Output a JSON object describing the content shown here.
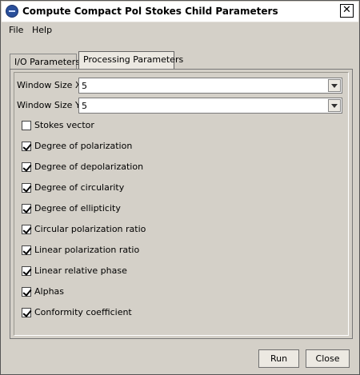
{
  "window": {
    "title": "Compute Compact Pol Stokes Child Parameters",
    "close_glyph": "✕",
    "icon": "app-logo-icon"
  },
  "menu": [
    "File",
    "Help"
  ],
  "tabs": [
    {
      "label": "I/O Parameters",
      "active": false
    },
    {
      "label": "Processing Parameters",
      "active": true
    }
  ],
  "fields": {
    "window_size_x": {
      "label": "Window Size X:",
      "value": "5"
    },
    "window_size_y": {
      "label": "Window Size Y:",
      "value": "5"
    }
  },
  "options": [
    {
      "label": "Stokes vector",
      "checked": false
    },
    {
      "label": "Degree of polarization",
      "checked": true
    },
    {
      "label": "Degree of depolarization",
      "checked": true
    },
    {
      "label": "Degree of circularity",
      "checked": true
    },
    {
      "label": "Degree of ellipticity",
      "checked": true
    },
    {
      "label": "Circular polarization ratio",
      "checked": true
    },
    {
      "label": "Linear polarization ratio",
      "checked": true
    },
    {
      "label": "Linear relative phase",
      "checked": true
    },
    {
      "label": "Alphas",
      "checked": true
    },
    {
      "label": "Conformity coefficient",
      "checked": true
    }
  ],
  "buttons": {
    "run": "Run",
    "close": "Close"
  }
}
